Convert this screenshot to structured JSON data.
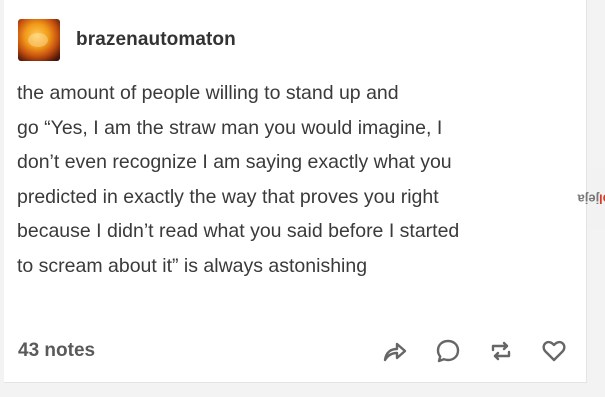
{
  "post": {
    "username": "brazenautomaton",
    "avatar_icon": "fiery-avatar-icon",
    "text_lines": [
      "the amount of people willing to stand up and",
      "go “Yes, I am the straw man you would imagine, I",
      "don’t even recognize I am saying exactly what you",
      "predicted in exactly the way that proves you right",
      "because I didn’t read what you said before I started",
      "to scream about it” is always astonishing"
    ],
    "notes": "43 notes",
    "actions": {
      "share_icon": "share-arrow-icon",
      "reply_icon": "reply-bubble-icon",
      "reblog_icon": "reblog-icon",
      "like_icon": "heart-icon"
    }
  },
  "watermark": {
    "main": "jeja",
    "suffix": ".pl"
  },
  "colors": {
    "text": "#3a3a3a",
    "username": "#333333",
    "icons": "#666666",
    "watermark_accent": "#d23a2a"
  }
}
